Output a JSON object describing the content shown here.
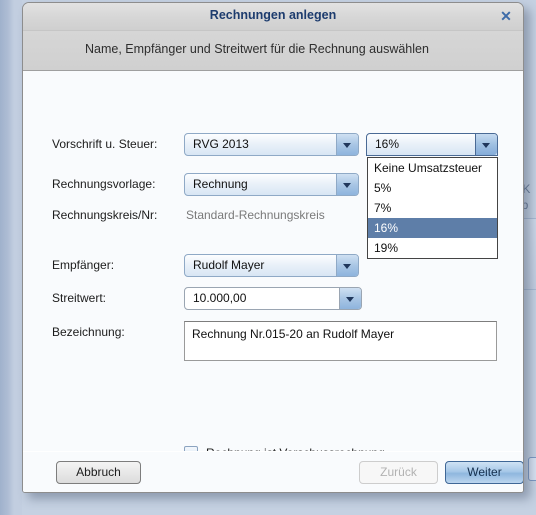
{
  "background": {
    "text_fragments": [
      "n, K",
      "ie b"
    ]
  },
  "dialog": {
    "title": "Rechnungen anlegen",
    "close_icon": "✕",
    "subtitle": "Name, Empfänger und Streitwert für die Rechnung auswählen",
    "fields": {
      "vorschrift": {
        "label": "Vorschrift u. Steuer:",
        "value": "RVG 2013"
      },
      "tax": {
        "value": "16%",
        "options": [
          "Keine Umsatzsteuer",
          "5%",
          "7%",
          "16%",
          "19%"
        ],
        "selected_index": 3
      },
      "vorlage": {
        "label": "Rechnungsvorlage:",
        "value": "Rechnung"
      },
      "rechnungskreis": {
        "label": "Rechnungskreis/Nr:",
        "value": "Standard-Rechnungskreis"
      },
      "empfaenger": {
        "label": "Empfänger:",
        "value": "Rudolf Mayer"
      },
      "streitwert": {
        "label": "Streitwert:",
        "value": "10.000,00"
      },
      "bezeichnung": {
        "label": "Bezeichnung:",
        "value": "Rechnung Nr.015-20 an Rudolf Mayer"
      },
      "vorschussrechnung": {
        "label": "Rechnung ist Vorschussrechnung",
        "checked": false
      }
    },
    "buttons": {
      "cancel": "Abbruch",
      "back": "Zurück",
      "next": "Weiter"
    }
  },
  "colors": {
    "title_text": "#1d3c6e",
    "accent": "#5e7ea8",
    "primary_button": "#8fb7de",
    "page_background": "#c5d1e2"
  }
}
